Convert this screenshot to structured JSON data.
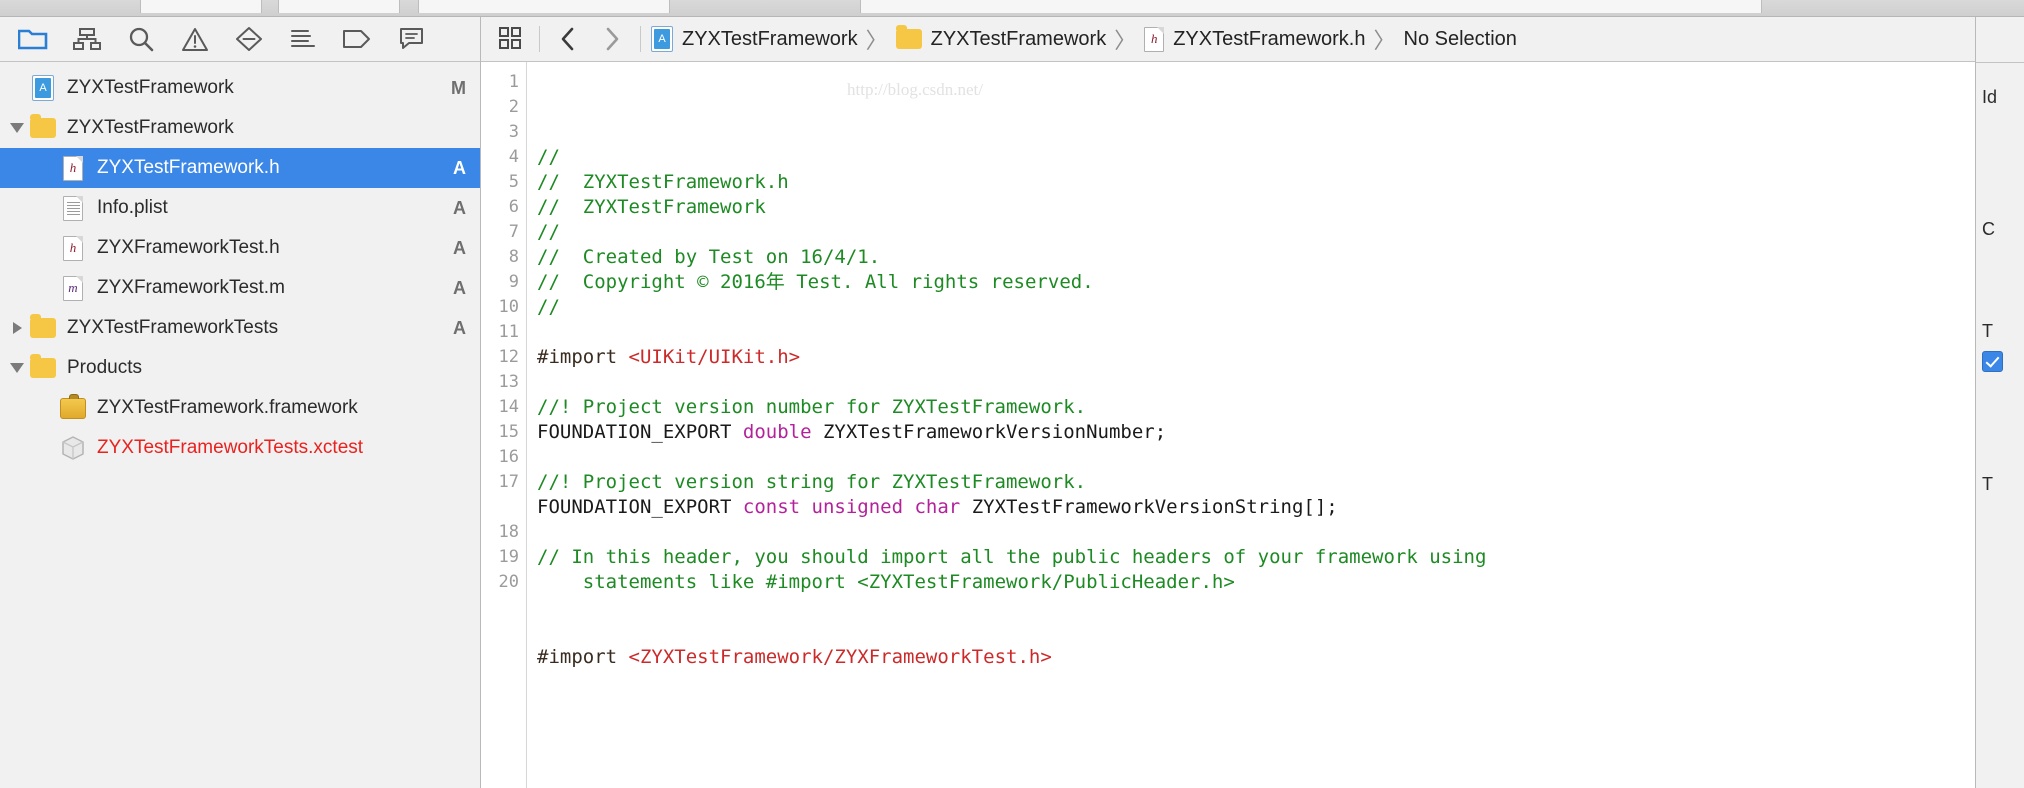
{
  "navigator": {
    "toolbar_icons": [
      {
        "name": "folder-icon",
        "title": "Project navigator"
      },
      {
        "name": "hierarchy-icon",
        "title": "Symbol navigator"
      },
      {
        "name": "search-icon",
        "title": "Find navigator"
      },
      {
        "name": "warning-triangle-icon",
        "title": "Issue navigator"
      },
      {
        "name": "test-diamond-icon",
        "title": "Test navigator"
      },
      {
        "name": "debug-list-icon",
        "title": "Debug navigator"
      },
      {
        "name": "tag-icon",
        "title": "Breakpoint navigator"
      },
      {
        "name": "report-bubble-icon",
        "title": "Report navigator"
      }
    ],
    "tree": [
      {
        "label": "ZYXTestFramework",
        "badge": "M",
        "icon": "xcodeproj-icon",
        "indent": 0,
        "twisty": "none",
        "selected": false,
        "red": false
      },
      {
        "label": "ZYXTestFramework",
        "badge": "",
        "icon": "folder-icon",
        "indent": 0,
        "twisty": "open",
        "selected": false,
        "red": false
      },
      {
        "label": "ZYXTestFramework.h",
        "badge": "A",
        "icon": "header-file-icon",
        "indent": 1,
        "twisty": "none",
        "selected": true,
        "red": false
      },
      {
        "label": "Info.plist",
        "badge": "A",
        "icon": "plist-file-icon",
        "indent": 1,
        "twisty": "none",
        "selected": false,
        "red": false
      },
      {
        "label": "ZYXFrameworkTest.h",
        "badge": "A",
        "icon": "header-file-icon",
        "indent": 1,
        "twisty": "none",
        "selected": false,
        "red": false
      },
      {
        "label": "ZYXFrameworkTest.m",
        "badge": "A",
        "icon": "implementation-file-icon",
        "indent": 1,
        "twisty": "none",
        "selected": false,
        "red": false
      },
      {
        "label": "ZYXTestFrameworkTests",
        "badge": "A",
        "icon": "folder-icon",
        "indent": 0,
        "twisty": "closed",
        "selected": false,
        "red": false
      },
      {
        "label": "Products",
        "badge": "",
        "icon": "folder-icon",
        "indent": 0,
        "twisty": "open",
        "selected": false,
        "red": false
      },
      {
        "label": "ZYXTestFramework.framework",
        "badge": "",
        "icon": "framework-toolbox-icon",
        "indent": 1,
        "twisty": "none",
        "selected": false,
        "red": false
      },
      {
        "label": "ZYXTestFrameworkTests.xctest",
        "badge": "",
        "icon": "xctest-cube-icon",
        "indent": 1,
        "twisty": "none",
        "selected": false,
        "red": true
      }
    ]
  },
  "jump_bar": {
    "grid_icon": "related-items-icon",
    "back_label": "‹",
    "forward_label": "›",
    "separator": "〉",
    "crumbs": [
      {
        "label": "ZYXTestFramework",
        "icon": "xcodeproj-icon"
      },
      {
        "label": "ZYXTestFramework",
        "icon": "folder-icon"
      },
      {
        "label": "ZYXTestFramework.h",
        "icon": "header-file-icon"
      },
      {
        "label": "No Selection",
        "icon": "none"
      }
    ]
  },
  "editor": {
    "watermark": "http://blog.csdn.net/",
    "line_numbers": [
      "1",
      "2",
      "3",
      "4",
      "5",
      "6",
      "7",
      "8",
      "9",
      "10",
      "11",
      "12",
      "13",
      "14",
      "15",
      "16",
      "17",
      "",
      "18",
      "19",
      "20"
    ],
    "lines": [
      {
        "n": "1",
        "segments": [
          {
            "t": "//",
            "c": "cmt"
          }
        ]
      },
      {
        "n": "2",
        "segments": [
          {
            "t": "//  ZYXTestFramework.h",
            "c": "cmt"
          }
        ]
      },
      {
        "n": "3",
        "segments": [
          {
            "t": "//  ZYXTestFramework",
            "c": "cmt"
          }
        ]
      },
      {
        "n": "4",
        "segments": [
          {
            "t": "//",
            "c": "cmt"
          }
        ]
      },
      {
        "n": "5",
        "segments": [
          {
            "t": "//  Created by Test on 16/4/1.",
            "c": "cmt"
          }
        ]
      },
      {
        "n": "6",
        "segments": [
          {
            "t": "//  Copyright © 2016年 Test. All rights reserved.",
            "c": "cmt"
          }
        ]
      },
      {
        "n": "7",
        "segments": [
          {
            "t": "//",
            "c": "cmt"
          }
        ]
      },
      {
        "n": "8",
        "segments": [
          {
            "t": "",
            "c": "plain"
          }
        ]
      },
      {
        "n": "9",
        "segments": [
          {
            "t": "#import ",
            "c": "pp"
          },
          {
            "t": "<UIKit/UIKit.h>",
            "c": "str"
          }
        ]
      },
      {
        "n": "10",
        "segments": [
          {
            "t": "",
            "c": "plain"
          }
        ]
      },
      {
        "n": "11",
        "segments": [
          {
            "t": "//! Project version number for ZYXTestFramework.",
            "c": "cmt"
          }
        ]
      },
      {
        "n": "12",
        "segments": [
          {
            "t": "FOUNDATION_EXPORT ",
            "c": "plain"
          },
          {
            "t": "double",
            "c": "kw"
          },
          {
            "t": " ZYXTestFrameworkVersionNumber;",
            "c": "plain"
          }
        ]
      },
      {
        "n": "13",
        "segments": [
          {
            "t": "",
            "c": "plain"
          }
        ]
      },
      {
        "n": "14",
        "segments": [
          {
            "t": "//! Project version string for ZYXTestFramework.",
            "c": "cmt"
          }
        ]
      },
      {
        "n": "15",
        "segments": [
          {
            "t": "FOUNDATION_EXPORT ",
            "c": "plain"
          },
          {
            "t": "const unsigned char",
            "c": "kw"
          },
          {
            "t": " ZYXTestFrameworkVersionString[];",
            "c": "plain"
          }
        ]
      },
      {
        "n": "16",
        "segments": [
          {
            "t": "",
            "c": "plain"
          }
        ]
      },
      {
        "n": "17",
        "segments": [
          {
            "t": "// In this header, you should import all the public headers of your framework using\n    statements like #import <ZYXTestFramework/PublicHeader.h>",
            "c": "cmt"
          }
        ]
      },
      {
        "n": "18",
        "segments": [
          {
            "t": "",
            "c": "plain"
          }
        ]
      },
      {
        "n": "19",
        "segments": [
          {
            "t": "",
            "c": "plain"
          }
        ]
      },
      {
        "n": "20",
        "segments": [
          {
            "t": "#import ",
            "c": "pp"
          },
          {
            "t": "<ZYXTestFramework/ZYXFrameworkTest.h>",
            "c": "str"
          }
        ]
      }
    ]
  },
  "inspector": {
    "fragments": [
      "Id",
      "C",
      "T"
    ],
    "checkbox_checked": true,
    "bottom_fragment": "T"
  },
  "colors": {
    "selection_blue": "#3b87e8",
    "comment_green": "#1d8a23",
    "string_red": "#cc2a2a",
    "keyword_magenta": "#b3229b",
    "error_red": "#e8231f",
    "chrome_gray": "#f1f1f1"
  }
}
